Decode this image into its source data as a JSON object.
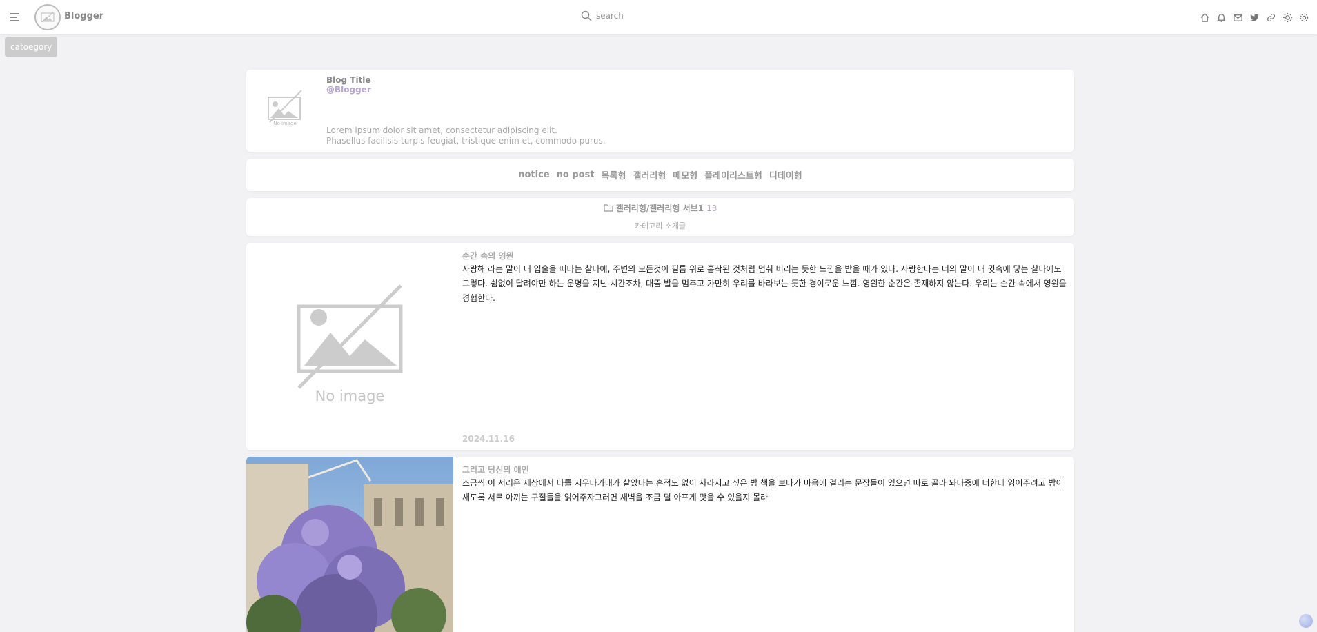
{
  "header": {
    "blog_name": "Blogger",
    "search_placeholder": "search",
    "icons": [
      "home-icon",
      "bell-icon",
      "mail-icon",
      "twitter-icon",
      "link-icon",
      "sun-icon",
      "settings-icon"
    ]
  },
  "category_button": "catoegory",
  "profile": {
    "title": "Blog Title",
    "handle": "@Blogger",
    "image_text": "No image",
    "desc_line1": "Lorem ipsum dolor sit amet, consectetur adipiscing elit.",
    "desc_line2": "Phasellus facilisis turpis feugiat, tristique enim et, commodo purus."
  },
  "nav": {
    "items": [
      "notice",
      "no post",
      "목록형",
      "갤러리형",
      "메모형",
      "플레이리스트형",
      "디데이형"
    ]
  },
  "category_info": {
    "path": "갤러리형/갤러리형 서브1",
    "count": "13",
    "description": "카테고리 소개글"
  },
  "posts": [
    {
      "title": "순간 속의 영원",
      "body": "사랑해 라는 말이 내 입술을 떠나는 찰나에, 주변의 모든것이 필름 위로 흡착된 것처럼 멈춰 버리는 듯한 느낌을 받을 때가 있다. 사랑한다는 너의 말이 내 귓속에 닿는 찰나에도 그렇다. 쉼없이 달려야만 하는 운명을 지닌 시간조차, 대뜸 발을 멈추고 가만히 우리를 바라보는 듯한 경이로운 느낌. 영원한 순간은 존재하지 않는다. 우리는 순간 속에서 영원을 경험한다.",
      "date": "2024.11.16",
      "image_text": "No image"
    },
    {
      "title": "그리고 당신의 애인",
      "body": "조금씩 이 서러운 세상에서 나를 지우다가내가 살았다는 흔적도 없이 사라지고 싶은 밤 책을 보다가 마음에 걸리는 문장들이 있으면 따로 골라 놔나중에 너한테 읽어주려고 밤이 새도록 서로 아끼는 구절들을 읽어주자그러면 새벽을 조금 덜 아프게 맛을 수 있을지 몰라"
    }
  ]
}
